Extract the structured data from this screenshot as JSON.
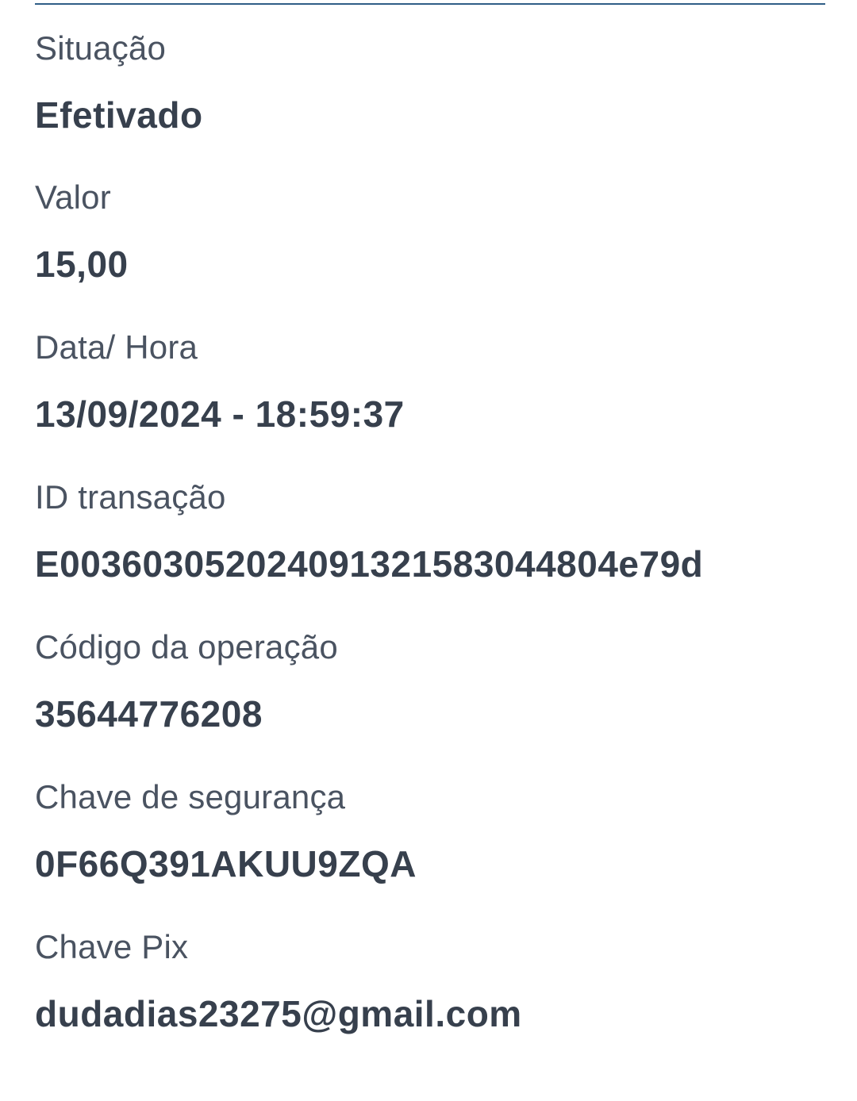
{
  "fields": [
    {
      "label": "Situação",
      "value": "Efetivado"
    },
    {
      "label": "Valor",
      "value": "15,00"
    },
    {
      "label": "Data/ Hora",
      "value": "13/09/2024 - 18:59:37"
    },
    {
      "label": "ID transação",
      "value": "E00360305202409132158304480 4e79d"
    },
    {
      "label": "Código da operação",
      "value": "35644776208"
    },
    {
      "label": "Chave de segurança",
      "value": "0F66Q391AKUU9ZQA"
    },
    {
      "label": "Chave Pix",
      "value": "dudadias23275@gmail.com"
    }
  ]
}
